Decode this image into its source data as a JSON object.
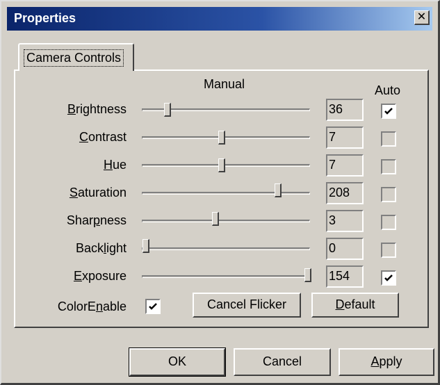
{
  "window": {
    "title": "Properties",
    "close_glyph": "✕"
  },
  "tabs": [
    {
      "label": "Camera Controls",
      "selected": true
    }
  ],
  "headers": {
    "manual": "Manual",
    "auto": "Auto"
  },
  "controls": [
    {
      "label": "Brightness",
      "value": "36",
      "auto": true,
      "auto_enabled": true
    },
    {
      "label": "Contrast",
      "value": "7",
      "auto": false,
      "auto_enabled": false
    },
    {
      "label": "Hue",
      "value": "7",
      "auto": false,
      "auto_enabled": false
    },
    {
      "label": "Saturation",
      "value": "208",
      "auto": false,
      "auto_enabled": false
    },
    {
      "label": "Sharpness",
      "value": "3",
      "auto": false,
      "auto_enabled": false
    },
    {
      "label": "Backlight",
      "value": "0",
      "auto": false,
      "auto_enabled": false
    },
    {
      "label": "Exposure",
      "value": "154",
      "auto": true,
      "auto_enabled": true
    }
  ],
  "color_enable": {
    "label": "ColorEnable",
    "checked": true
  },
  "buttons": {
    "cancel_flicker": "Cancel Flicker",
    "default": "Default",
    "ok": "OK",
    "cancel": "Cancel",
    "apply": "Apply"
  },
  "colors": {
    "title_bar_start": "#0a246a",
    "title_bar_end": "#a6caf0",
    "face": "#d4d0c8"
  }
}
